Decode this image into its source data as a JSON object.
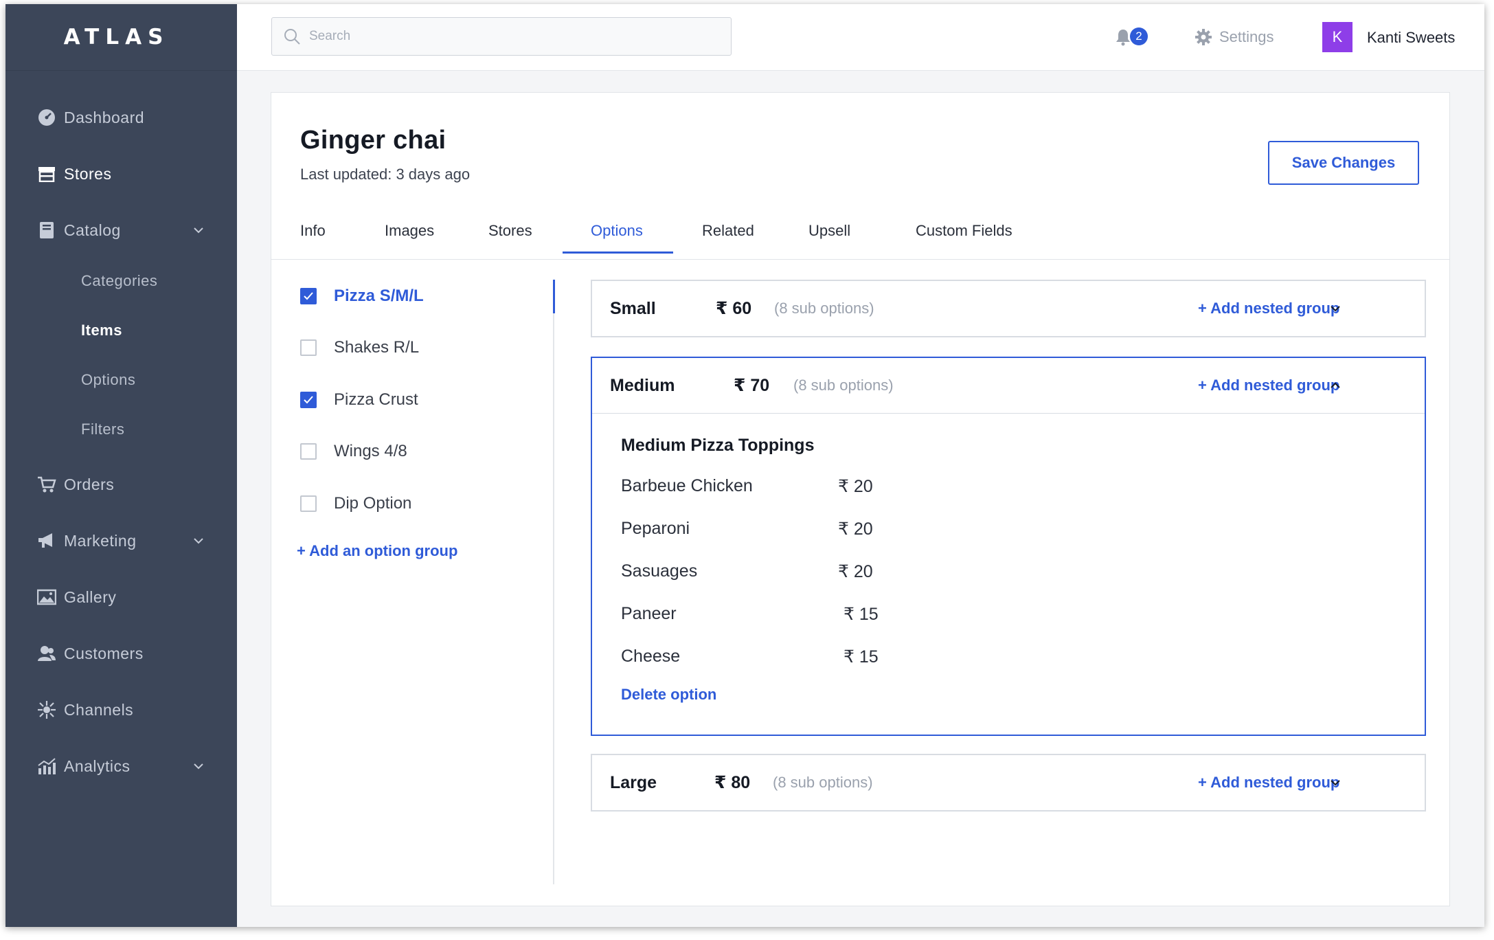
{
  "app": {
    "logo": "ATLAS"
  },
  "sidebar": {
    "items": [
      {
        "label": "Dashboard",
        "icon": "dashboard-icon"
      },
      {
        "label": "Stores",
        "icon": "store-icon"
      },
      {
        "label": "Catalog",
        "icon": "catalog-icon"
      },
      {
        "label": "Orders",
        "icon": "cart-icon"
      },
      {
        "label": "Marketing",
        "icon": "megaphone-icon"
      },
      {
        "label": "Gallery",
        "icon": "image-icon"
      },
      {
        "label": "Customers",
        "icon": "users-icon"
      },
      {
        "label": "Channels",
        "icon": "channels-icon"
      },
      {
        "label": "Analytics",
        "icon": "analytics-icon"
      }
    ],
    "catalog_sub": [
      {
        "label": "Categories"
      },
      {
        "label": "Items"
      },
      {
        "label": "Options"
      },
      {
        "label": "Filters"
      }
    ]
  },
  "topbar": {
    "search_placeholder": "Search",
    "notification_count": "2",
    "settings_label": "Settings",
    "avatar_initial": "K",
    "username": "Kanti Sweets"
  },
  "page": {
    "title": "Ginger chai",
    "subtitle": "Last updated: 3 days ago",
    "save_label": "Save Changes",
    "tabs": [
      {
        "label": "Info"
      },
      {
        "label": "Images"
      },
      {
        "label": "Stores"
      },
      {
        "label": "Options"
      },
      {
        "label": "Related"
      },
      {
        "label": "Upsell"
      },
      {
        "label": "Custom Fields"
      }
    ]
  },
  "option_groups": [
    {
      "label": "Pizza S/M/L",
      "checked": true
    },
    {
      "label": "Shakes R/L",
      "checked": false
    },
    {
      "label": "Pizza Crust",
      "checked": true
    },
    {
      "label": "Wings 4/8",
      "checked": false
    },
    {
      "label": "Dip Option",
      "checked": false
    }
  ],
  "add_option_group_label": "+ Add an option group",
  "options": [
    {
      "name": "Small",
      "price": "₹ 60",
      "sub": "(8 sub options)",
      "nested_label": "+ Add nested group"
    },
    {
      "name": "Medium",
      "price": "₹ 70",
      "sub": "(8 sub options)",
      "nested_label": "+ Add nested group"
    },
    {
      "name": "Large",
      "price": "₹ 80",
      "sub": "(8 sub options)",
      "nested_label": "+ Add nested group"
    }
  ],
  "medium_detail": {
    "title": "Medium Pizza Toppings",
    "toppings": [
      {
        "name": "Barbeue Chicken",
        "price": "₹ 20"
      },
      {
        "name": "Peparoni",
        "price": "₹ 20"
      },
      {
        "name": "Sasuages",
        "price": "₹ 20"
      },
      {
        "name": "Paneer",
        "price": "₹ 15"
      },
      {
        "name": "Cheese",
        "price": "₹ 15"
      }
    ],
    "delete_label": "Delete option"
  },
  "colors": {
    "sidebar": "#3c4659",
    "accent": "#2f5bd8",
    "avatar": "#8e3ee8"
  }
}
